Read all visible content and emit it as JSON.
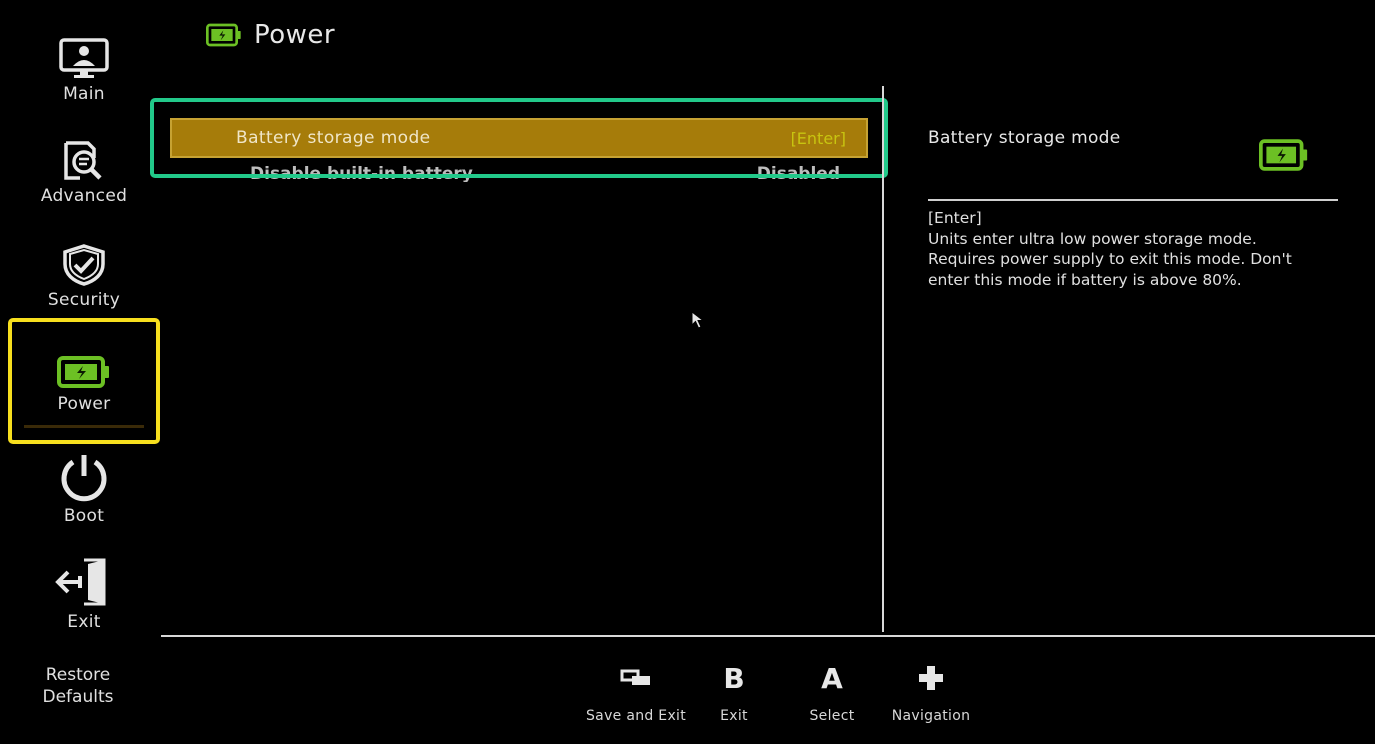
{
  "sidebar": {
    "items": [
      {
        "label": "Main",
        "icon": "monitor-user-icon"
      },
      {
        "label": "Advanced",
        "icon": "document-search-icon"
      },
      {
        "label": "Security",
        "icon": "shield-check-icon"
      },
      {
        "label": "Power",
        "icon": "battery-icon",
        "selected": true
      },
      {
        "label": "Boot",
        "icon": "power-icon"
      },
      {
        "label": "Exit",
        "icon": "exit-door-icon"
      }
    ],
    "restore_defaults_line1": "Restore",
    "restore_defaults_line2": "Defaults"
  },
  "header": {
    "title": "Power",
    "icon": "battery-icon"
  },
  "settings": {
    "rows": [
      {
        "label": "Battery storage mode",
        "value": "[Enter]",
        "selected": true
      },
      {
        "label": "Disable built-in battery",
        "value": "Disabled"
      }
    ]
  },
  "help": {
    "title": "Battery storage mode",
    "lines": [
      "[Enter]",
      "Units enter ultra low power storage mode.",
      "Requires power supply to exit this mode. Don't",
      "enter this mode if battery is above 80%."
    ]
  },
  "footer": {
    "hints": [
      {
        "glyph": "",
        "label": "Save and Exit",
        "icon": "view-button-icon"
      },
      {
        "glyph": "B",
        "label": "Exit"
      },
      {
        "glyph": "A",
        "label": "Select"
      },
      {
        "glyph": "",
        "label": "Navigation",
        "icon": "dpad-icon"
      }
    ]
  },
  "colors": {
    "accent_green": "#6cc024",
    "selection_frame": "#22c98a",
    "sidebar_selection": "#f7df1e",
    "row_highlight": "#a67c0a"
  }
}
